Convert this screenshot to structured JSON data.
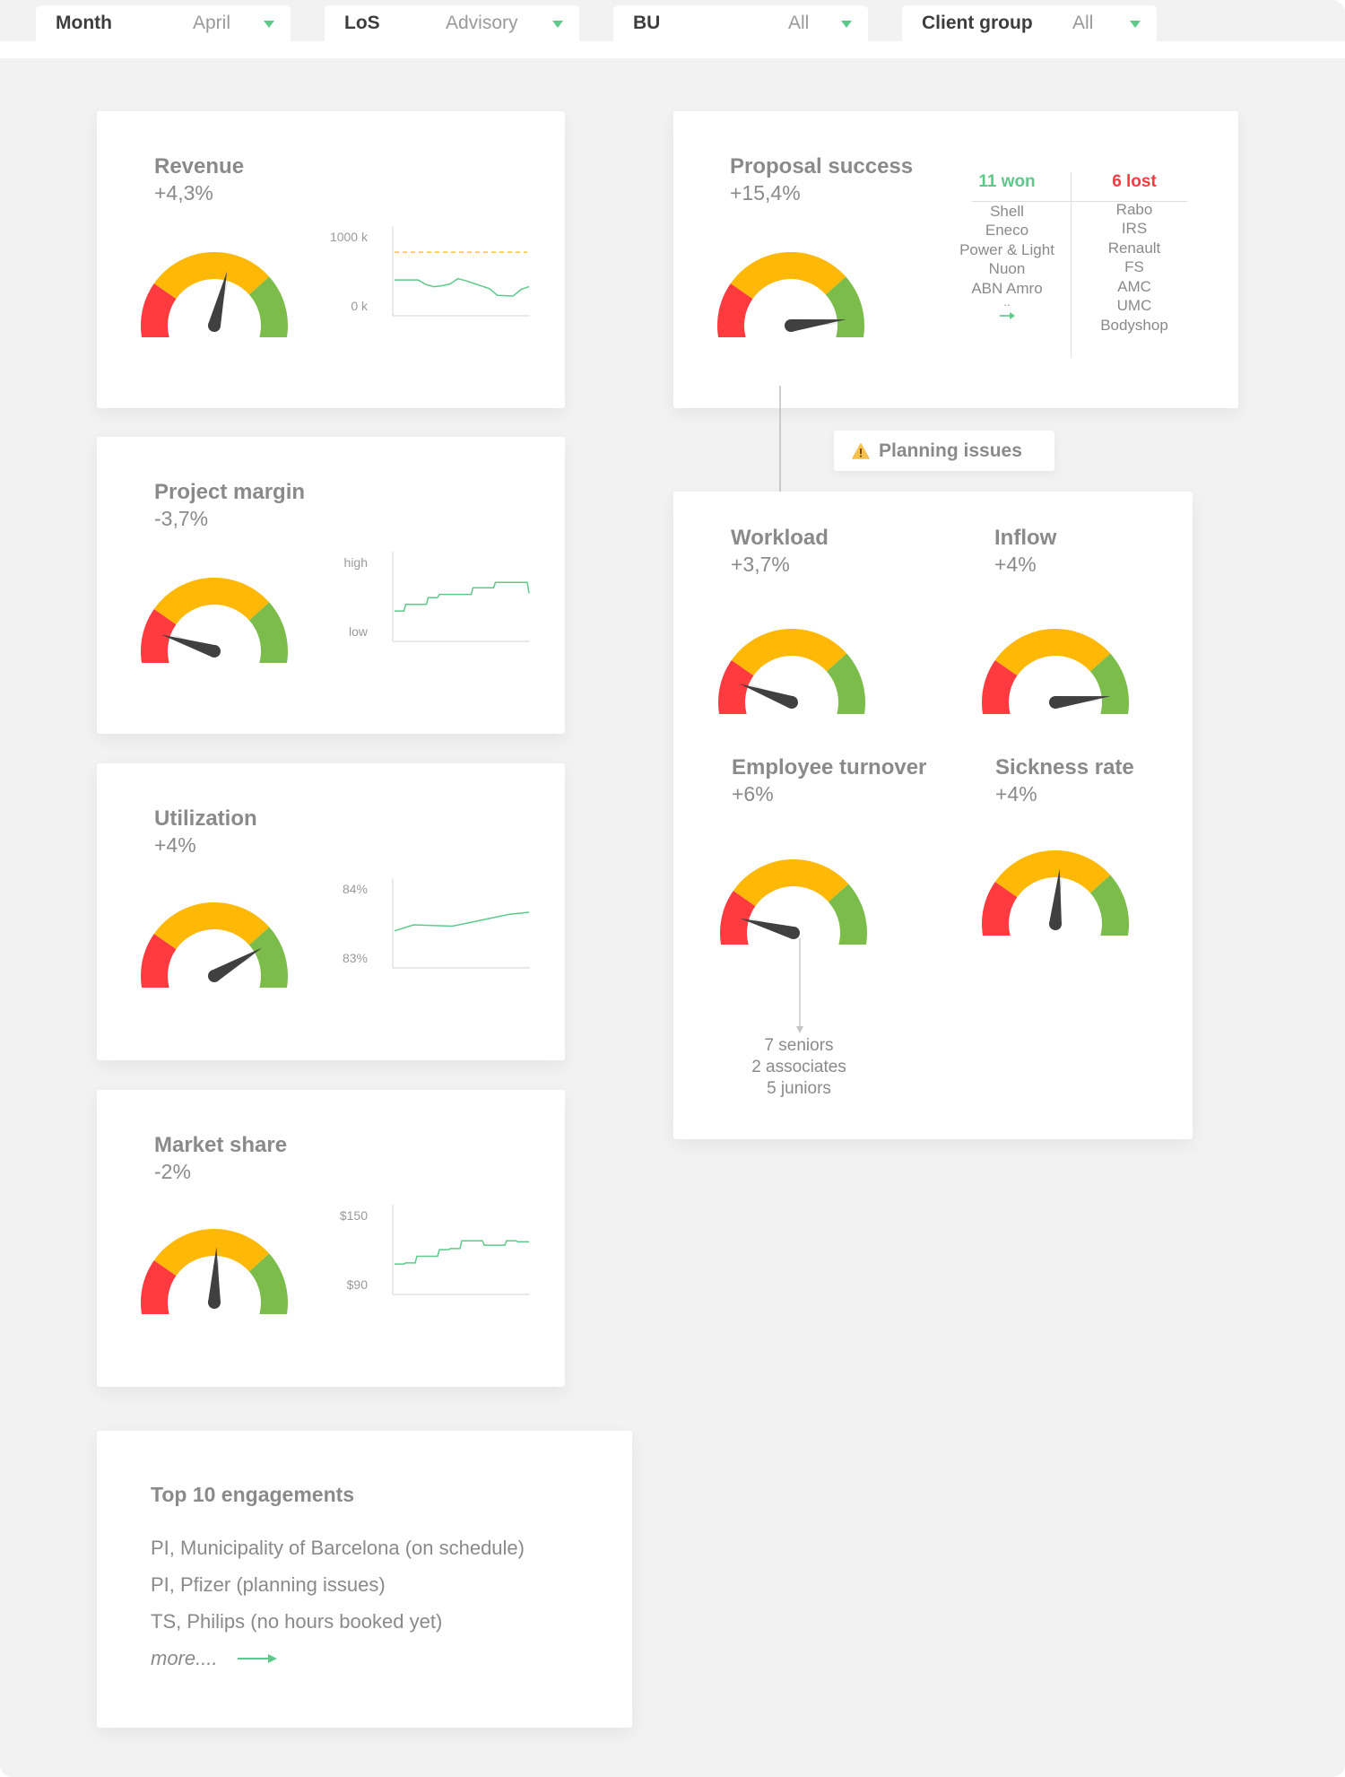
{
  "filters": [
    {
      "label": "Month",
      "value": "April"
    },
    {
      "label": "LoS",
      "value": "Advisory"
    },
    {
      "label": "BU",
      "value": "All"
    },
    {
      "label": "Client group",
      "value": "All"
    }
  ],
  "colors": {
    "gauge_red": "#ff3b3f",
    "gauge_amber": "#ffb805",
    "gauge_green": "#7cbc4a",
    "needle": "#404040",
    "spark_line": "#5dc98b",
    "target_line": "#ffb805",
    "won": "#5dc98b",
    "lost": "#ff3b3f",
    "accent_caret": "#5dc98b"
  },
  "cards": {
    "revenue": {
      "title": "Revenue",
      "delta": "+4,3%",
      "gauge_value": 0.56,
      "y_top": "1000 k",
      "y_bottom": "0 k"
    },
    "project_margin": {
      "title": "Project margin",
      "delta": "-3,7%",
      "gauge_value": 0.17,
      "y_top": "high",
      "y_bottom": "low"
    },
    "utilization": {
      "title": "Utilization",
      "delta": "+4%",
      "gauge_value": 0.77,
      "y_top": "84%",
      "y_bottom": "83%"
    },
    "market_share": {
      "title": "Market share",
      "delta": "-2%",
      "gauge_value": 0.51,
      "y_top": "$150",
      "y_bottom": "$90"
    },
    "proposal_success": {
      "title": "Proposal success",
      "delta": "+15,4%",
      "gauge_value": 0.88,
      "won_header": "11 won",
      "lost_header": "6 lost",
      "won": [
        "Shell",
        "Eneco",
        "Power & Light",
        "Nuon",
        "ABN Amro"
      ],
      "won_ellipsis": "..",
      "lost": [
        "Rabo",
        "IRS",
        "Renault",
        "FS",
        "AMC",
        "UMC",
        "Bodyshop"
      ]
    },
    "planning_badge": {
      "label": "Planning issues"
    },
    "workload": {
      "title": "Workload",
      "delta": "+3,7%",
      "gauge_value": 0.18
    },
    "inflow": {
      "title": "Inflow",
      "delta": "+4%",
      "gauge_value": 0.88
    },
    "employee_turnover": {
      "title": "Employee turnover",
      "delta": "+6%",
      "gauge_value": 0.16,
      "breakdown": [
        "7 seniors",
        "2 associates",
        "5 juniors"
      ]
    },
    "sickness_rate": {
      "title": "Sickness rate",
      "delta": "+4%",
      "gauge_value": 0.52
    },
    "top_engagements": {
      "title": "Top 10 engagements",
      "items": [
        "PI, Municipality of Barcelona (on schedule)",
        "PI, Pfizer (planning issues)",
        "TS, Philips (no hours booked yet)"
      ],
      "more": "more...."
    }
  },
  "chart_data": [
    {
      "type": "line",
      "title": "Revenue",
      "ylabel": "",
      "xlabel": "",
      "y_tick_labels": [
        "1000 k",
        "0 k"
      ],
      "ylim": [
        0,
        1000
      ],
      "target": 850,
      "values": [
        430,
        430,
        430,
        430,
        360,
        330,
        345,
        370,
        450,
        420,
        380,
        340,
        300,
        200,
        195,
        190,
        290,
        330
      ]
    },
    {
      "type": "line",
      "title": "Project margin",
      "ylabel": "",
      "xlabel": "",
      "y_tick_labels": [
        "high",
        "low"
      ],
      "ylim": [
        0,
        1
      ],
      "step": true,
      "values": [
        0.35,
        0.45,
        0.45,
        0.55,
        0.6,
        0.6,
        0.6,
        0.7,
        0.7,
        0.78,
        0.78,
        0.78,
        0.62
      ]
    },
    {
      "type": "line",
      "title": "Utilization",
      "ylabel": "",
      "xlabel": "",
      "y_tick_labels": [
        "84%",
        "83%"
      ],
      "ylim": [
        83,
        84
      ],
      "values": [
        83.45,
        83.54,
        83.53,
        83.52,
        83.58,
        83.64,
        83.7,
        83.73
      ]
    },
    {
      "type": "line",
      "title": "Market share",
      "ylabel": "",
      "xlabel": "",
      "y_tick_labels": [
        "$150",
        "$90"
      ],
      "ylim": [
        90,
        150
      ],
      "step": true,
      "values": [
        111,
        112,
        118,
        118,
        124,
        125,
        132,
        132,
        128,
        128,
        132,
        131,
        131
      ]
    }
  ]
}
